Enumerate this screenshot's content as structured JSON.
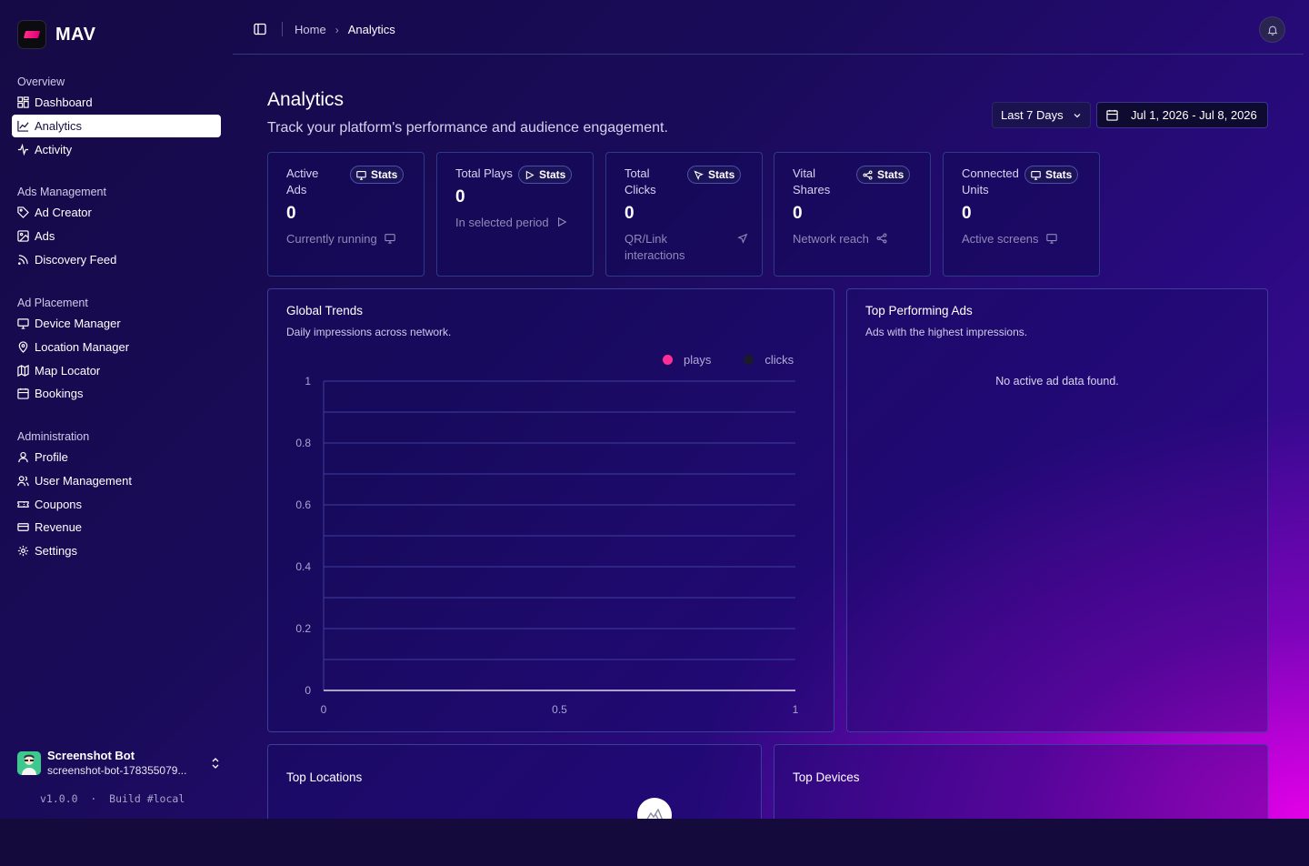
{
  "brand": {
    "name": "MAV"
  },
  "sidebar": {
    "sections": [
      {
        "title": "Overview",
        "items": [
          {
            "label": "Dashboard",
            "icon": "dashboard-icon"
          },
          {
            "label": "Analytics",
            "icon": "chart-line-icon",
            "active": true
          },
          {
            "label": "Activity",
            "icon": "activity-icon"
          }
        ]
      },
      {
        "title": "Ads Management",
        "items": [
          {
            "label": "Ad Creator",
            "icon": "tag-icon"
          },
          {
            "label": "Ads",
            "icon": "image-icon"
          },
          {
            "label": "Discovery Feed",
            "icon": "rss-icon"
          }
        ]
      },
      {
        "title": "Ad Placement",
        "items": [
          {
            "label": "Device Manager",
            "icon": "monitor-icon"
          },
          {
            "label": "Location Manager",
            "icon": "map-pin-icon"
          },
          {
            "label": "Map Locator",
            "icon": "map-icon"
          },
          {
            "label": "Bookings",
            "icon": "calendar-icon"
          }
        ]
      },
      {
        "title": "Administration",
        "items": [
          {
            "label": "Profile",
            "icon": "user-icon"
          },
          {
            "label": "User Management",
            "icon": "users-icon"
          },
          {
            "label": "Coupons",
            "icon": "ticket-icon"
          },
          {
            "label": "Revenue",
            "icon": "credit-card-icon"
          },
          {
            "label": "Settings",
            "icon": "gear-icon"
          }
        ]
      }
    ],
    "user": {
      "name": "Screenshot Bot",
      "email": "screenshot-bot-178355079..."
    },
    "version": "v1.0.0  ·  Build #local"
  },
  "header": {
    "breadcrumb": {
      "home": "Home",
      "current": "Analytics"
    }
  },
  "page": {
    "title": "Analytics",
    "subtitle": "Track your platform's performance and audience engagement.",
    "range_label": "Last 7 Days",
    "date_range": "Jul 1, 2026 - Jul 8, 2026"
  },
  "stats": [
    {
      "label": "Active Ads",
      "value": "0",
      "foot": "Currently running",
      "badge": "Stats",
      "icon": "monitor-icon"
    },
    {
      "label": "Total Plays",
      "value": "0",
      "foot": "In selected period",
      "badge": "Stats",
      "icon": "play-icon"
    },
    {
      "label": "Total Clicks",
      "value": "0",
      "foot": "QR/Link interactions",
      "badge": "Stats",
      "icon": "cursor-icon"
    },
    {
      "label": "Vital Shares",
      "value": "0",
      "foot": "Network reach",
      "badge": "Stats",
      "icon": "share-icon"
    },
    {
      "label": "Connected Units",
      "value": "0",
      "foot": "Active screens",
      "badge": "Stats",
      "icon": "screen-icon"
    }
  ],
  "trends": {
    "title": "Global Trends",
    "subtitle": "Daily impressions across network."
  },
  "top_ads": {
    "title": "Top Performing Ads",
    "subtitle": "Ads with the highest impressions.",
    "empty": "No active ad data found."
  },
  "top_locations": {
    "title": "Top Locations"
  },
  "top_devices": {
    "title": "Top Devices"
  },
  "colors": {
    "plays": "#ff2d95",
    "clicks": "#1a1a2a",
    "accent": "#ffffff"
  },
  "chart_data": {
    "type": "line",
    "series": [
      {
        "name": "plays",
        "values": []
      },
      {
        "name": "clicks",
        "values": []
      }
    ],
    "x": [],
    "xlabel": "",
    "ylabel": "",
    "xlim": [
      0,
      1
    ],
    "ylim": [
      0,
      1
    ],
    "x_ticks": [
      "0",
      "0.5",
      "1"
    ],
    "y_ticks": [
      "1",
      "0.8",
      "0.6",
      "0.4",
      "0.2",
      "0"
    ],
    "grid": true,
    "legend": "top-right"
  }
}
